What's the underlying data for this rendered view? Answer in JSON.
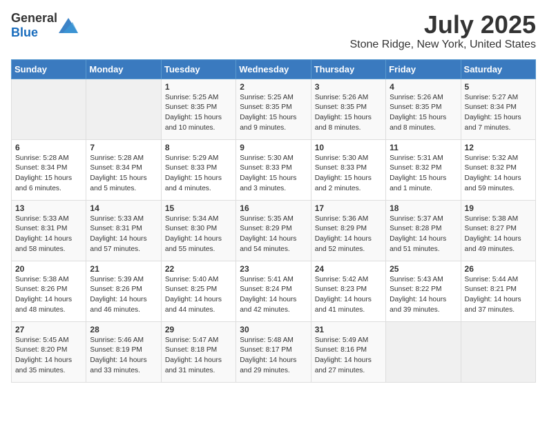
{
  "header": {
    "logo_general": "General",
    "logo_blue": "Blue",
    "month": "July 2025",
    "location": "Stone Ridge, New York, United States"
  },
  "weekdays": [
    "Sunday",
    "Monday",
    "Tuesday",
    "Wednesday",
    "Thursday",
    "Friday",
    "Saturday"
  ],
  "weeks": [
    [
      {
        "day": "",
        "sunrise": "",
        "sunset": "",
        "daylight": ""
      },
      {
        "day": "",
        "sunrise": "",
        "sunset": "",
        "daylight": ""
      },
      {
        "day": "1",
        "sunrise": "Sunrise: 5:25 AM",
        "sunset": "Sunset: 8:35 PM",
        "daylight": "Daylight: 15 hours and 10 minutes."
      },
      {
        "day": "2",
        "sunrise": "Sunrise: 5:25 AM",
        "sunset": "Sunset: 8:35 PM",
        "daylight": "Daylight: 15 hours and 9 minutes."
      },
      {
        "day": "3",
        "sunrise": "Sunrise: 5:26 AM",
        "sunset": "Sunset: 8:35 PM",
        "daylight": "Daylight: 15 hours and 8 minutes."
      },
      {
        "day": "4",
        "sunrise": "Sunrise: 5:26 AM",
        "sunset": "Sunset: 8:35 PM",
        "daylight": "Daylight: 15 hours and 8 minutes."
      },
      {
        "day": "5",
        "sunrise": "Sunrise: 5:27 AM",
        "sunset": "Sunset: 8:34 PM",
        "daylight": "Daylight: 15 hours and 7 minutes."
      }
    ],
    [
      {
        "day": "6",
        "sunrise": "Sunrise: 5:28 AM",
        "sunset": "Sunset: 8:34 PM",
        "daylight": "Daylight: 15 hours and 6 minutes."
      },
      {
        "day": "7",
        "sunrise": "Sunrise: 5:28 AM",
        "sunset": "Sunset: 8:34 PM",
        "daylight": "Daylight: 15 hours and 5 minutes."
      },
      {
        "day": "8",
        "sunrise": "Sunrise: 5:29 AM",
        "sunset": "Sunset: 8:33 PM",
        "daylight": "Daylight: 15 hours and 4 minutes."
      },
      {
        "day": "9",
        "sunrise": "Sunrise: 5:30 AM",
        "sunset": "Sunset: 8:33 PM",
        "daylight": "Daylight: 15 hours and 3 minutes."
      },
      {
        "day": "10",
        "sunrise": "Sunrise: 5:30 AM",
        "sunset": "Sunset: 8:33 PM",
        "daylight": "Daylight: 15 hours and 2 minutes."
      },
      {
        "day": "11",
        "sunrise": "Sunrise: 5:31 AM",
        "sunset": "Sunset: 8:32 PM",
        "daylight": "Daylight: 15 hours and 1 minute."
      },
      {
        "day": "12",
        "sunrise": "Sunrise: 5:32 AM",
        "sunset": "Sunset: 8:32 PM",
        "daylight": "Daylight: 14 hours and 59 minutes."
      }
    ],
    [
      {
        "day": "13",
        "sunrise": "Sunrise: 5:33 AM",
        "sunset": "Sunset: 8:31 PM",
        "daylight": "Daylight: 14 hours and 58 minutes."
      },
      {
        "day": "14",
        "sunrise": "Sunrise: 5:33 AM",
        "sunset": "Sunset: 8:31 PM",
        "daylight": "Daylight: 14 hours and 57 minutes."
      },
      {
        "day": "15",
        "sunrise": "Sunrise: 5:34 AM",
        "sunset": "Sunset: 8:30 PM",
        "daylight": "Daylight: 14 hours and 55 minutes."
      },
      {
        "day": "16",
        "sunrise": "Sunrise: 5:35 AM",
        "sunset": "Sunset: 8:29 PM",
        "daylight": "Daylight: 14 hours and 54 minutes."
      },
      {
        "day": "17",
        "sunrise": "Sunrise: 5:36 AM",
        "sunset": "Sunset: 8:29 PM",
        "daylight": "Daylight: 14 hours and 52 minutes."
      },
      {
        "day": "18",
        "sunrise": "Sunrise: 5:37 AM",
        "sunset": "Sunset: 8:28 PM",
        "daylight": "Daylight: 14 hours and 51 minutes."
      },
      {
        "day": "19",
        "sunrise": "Sunrise: 5:38 AM",
        "sunset": "Sunset: 8:27 PM",
        "daylight": "Daylight: 14 hours and 49 minutes."
      }
    ],
    [
      {
        "day": "20",
        "sunrise": "Sunrise: 5:38 AM",
        "sunset": "Sunset: 8:26 PM",
        "daylight": "Daylight: 14 hours and 48 minutes."
      },
      {
        "day": "21",
        "sunrise": "Sunrise: 5:39 AM",
        "sunset": "Sunset: 8:26 PM",
        "daylight": "Daylight: 14 hours and 46 minutes."
      },
      {
        "day": "22",
        "sunrise": "Sunrise: 5:40 AM",
        "sunset": "Sunset: 8:25 PM",
        "daylight": "Daylight: 14 hours and 44 minutes."
      },
      {
        "day": "23",
        "sunrise": "Sunrise: 5:41 AM",
        "sunset": "Sunset: 8:24 PM",
        "daylight": "Daylight: 14 hours and 42 minutes."
      },
      {
        "day": "24",
        "sunrise": "Sunrise: 5:42 AM",
        "sunset": "Sunset: 8:23 PM",
        "daylight": "Daylight: 14 hours and 41 minutes."
      },
      {
        "day": "25",
        "sunrise": "Sunrise: 5:43 AM",
        "sunset": "Sunset: 8:22 PM",
        "daylight": "Daylight: 14 hours and 39 minutes."
      },
      {
        "day": "26",
        "sunrise": "Sunrise: 5:44 AM",
        "sunset": "Sunset: 8:21 PM",
        "daylight": "Daylight: 14 hours and 37 minutes."
      }
    ],
    [
      {
        "day": "27",
        "sunrise": "Sunrise: 5:45 AM",
        "sunset": "Sunset: 8:20 PM",
        "daylight": "Daylight: 14 hours and 35 minutes."
      },
      {
        "day": "28",
        "sunrise": "Sunrise: 5:46 AM",
        "sunset": "Sunset: 8:19 PM",
        "daylight": "Daylight: 14 hours and 33 minutes."
      },
      {
        "day": "29",
        "sunrise": "Sunrise: 5:47 AM",
        "sunset": "Sunset: 8:18 PM",
        "daylight": "Daylight: 14 hours and 31 minutes."
      },
      {
        "day": "30",
        "sunrise": "Sunrise: 5:48 AM",
        "sunset": "Sunset: 8:17 PM",
        "daylight": "Daylight: 14 hours and 29 minutes."
      },
      {
        "day": "31",
        "sunrise": "Sunrise: 5:49 AM",
        "sunset": "Sunset: 8:16 PM",
        "daylight": "Daylight: 14 hours and 27 minutes."
      },
      {
        "day": "",
        "sunrise": "",
        "sunset": "",
        "daylight": ""
      },
      {
        "day": "",
        "sunrise": "",
        "sunset": "",
        "daylight": ""
      }
    ]
  ]
}
